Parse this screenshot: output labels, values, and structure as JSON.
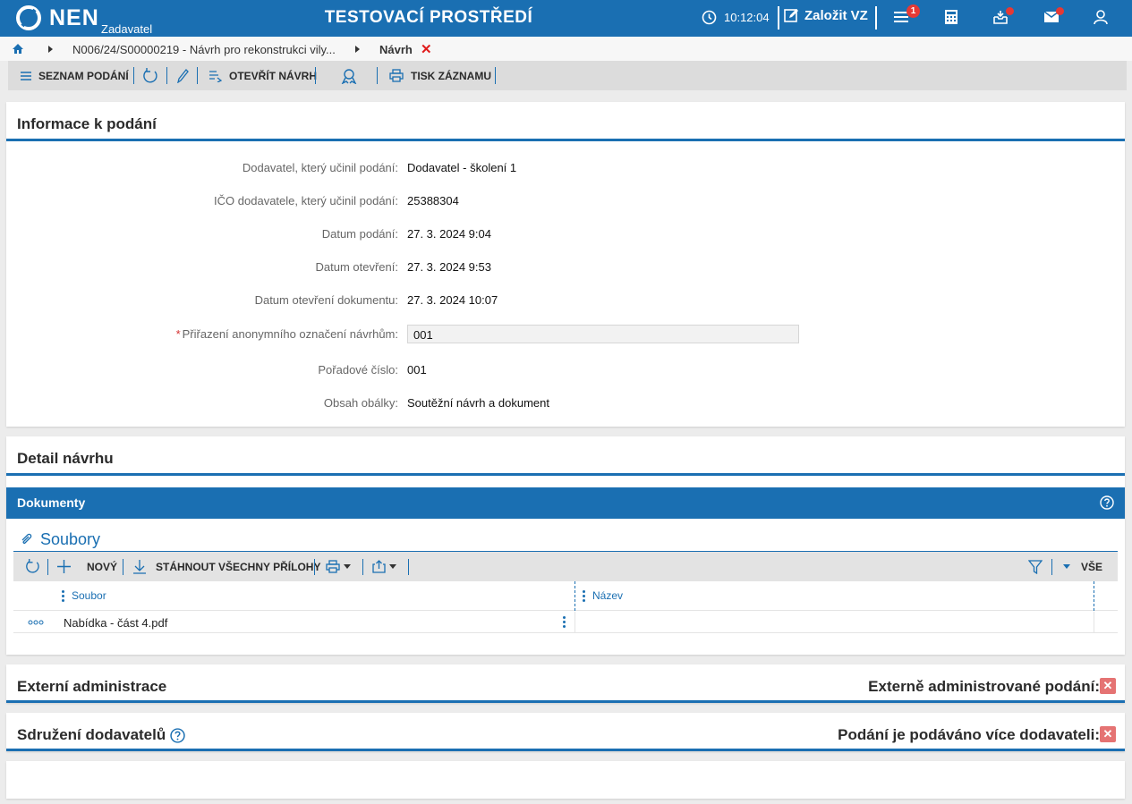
{
  "header": {
    "logo_text": "NEN",
    "logo_sub": "Zadavatel",
    "environment_title": "TESTOVACÍ PROSTŘEDÍ",
    "time": "10:12:04",
    "create_vz_label": "Založit VZ",
    "menu_badge": "1"
  },
  "breadcrumb": {
    "item1": "N006/24/S00000219 - Návrh pro rekonstrukci vily...",
    "item2": "Návrh",
    "close_glyph": "✕"
  },
  "toolbar": {
    "list_label": "SEZNAM PODÁNÍ",
    "open_label": "OTEVŘÍT NÁVRH",
    "print_label": "TISK ZÁZNAMU"
  },
  "info": {
    "title": "Informace k podání",
    "fields": [
      {
        "label": "Dodavatel, který učinil podání:",
        "value": "Dodavatel - školení 1"
      },
      {
        "label": "IČO dodavatele, který učinil podání:",
        "value": "25388304"
      },
      {
        "label": "Datum podání:",
        "value": "27. 3. 2024 9:04"
      },
      {
        "label": "Datum otevření:",
        "value": "27. 3. 2024 9:53"
      },
      {
        "label": "Datum otevření dokumentu:",
        "value": "27. 3. 2024 10:07"
      },
      {
        "label": "Přiřazení anonymního označení návrhům:",
        "value": "001",
        "required_mark": "*"
      },
      {
        "label": "Pořadové číslo:",
        "value": "001"
      },
      {
        "label": "Obsah obálky:",
        "value": "Soutěžní návrh a dokument"
      }
    ]
  },
  "detail": {
    "title": "Detail návrhu",
    "documents_title": "Dokumenty",
    "files_title": "Soubory",
    "grid_toolbar": {
      "new_label": "NOVÝ",
      "download_all_label": "STÁHNOUT VŠECHNY PŘÍLOHY",
      "all_label": "VŠE"
    },
    "columns": [
      "Soubor",
      "Název"
    ],
    "rows": [
      {
        "file": "Nabídka - část 4.pdf",
        "name": ""
      }
    ]
  },
  "external": {
    "title": "Externí administrace",
    "flag_label": "Externě administrované podání:"
  },
  "association": {
    "title": "Sdružení dodavatelů",
    "flag_label": "Podání je podáváno více dodavateli:"
  },
  "colors": {
    "primary": "#1a6fb2",
    "badge": "#e53935",
    "false_flag": "#e57373"
  }
}
